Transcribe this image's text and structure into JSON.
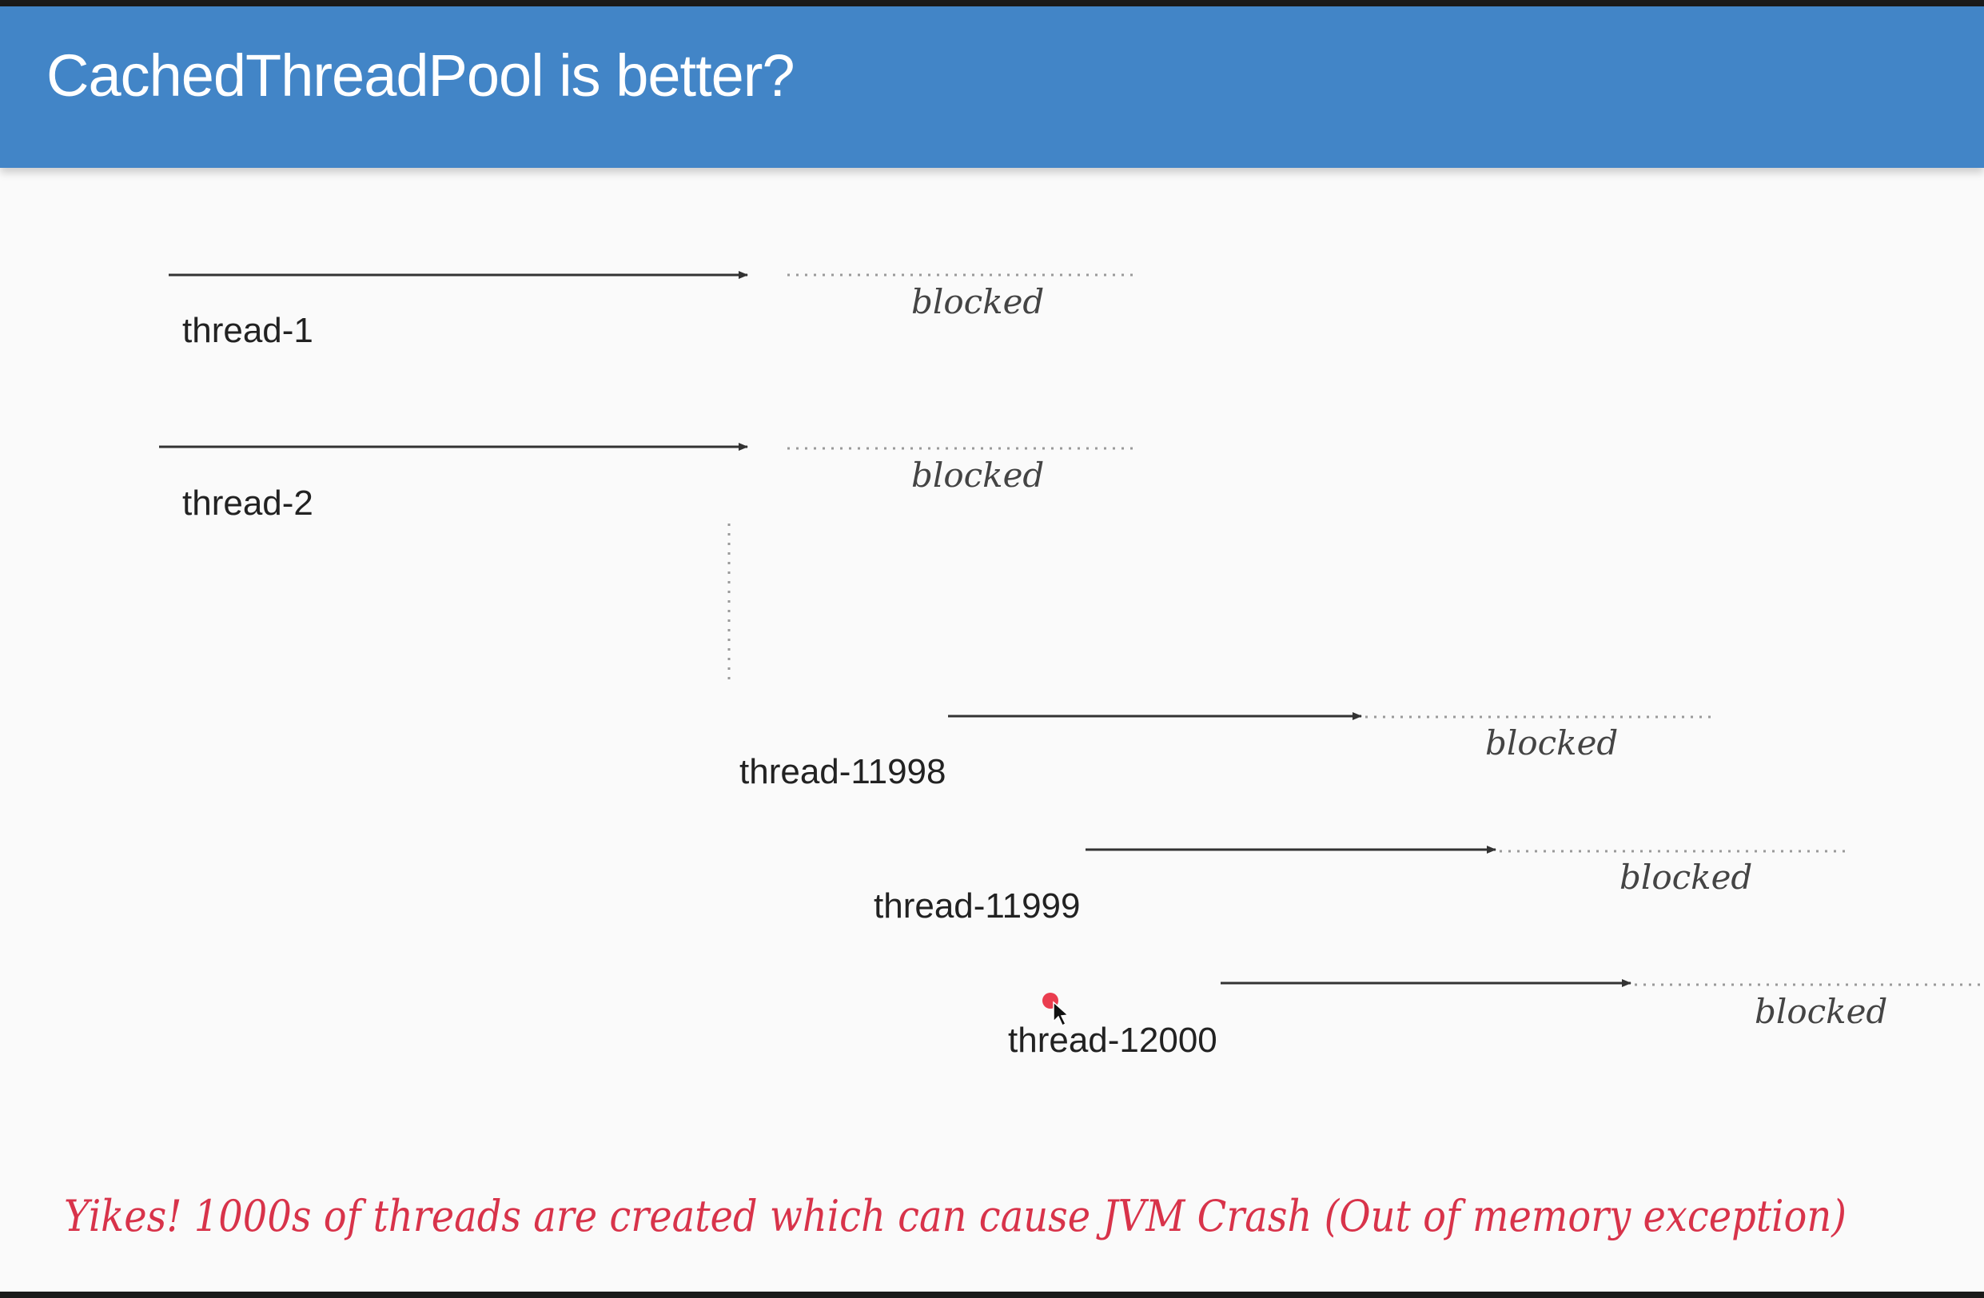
{
  "slide": {
    "title": "CachedThreadPool is better?"
  },
  "threads": [
    {
      "id": "thread-1",
      "label": "thread-1",
      "state": "blocked"
    },
    {
      "id": "thread-2",
      "label": "thread-2",
      "state": "blocked"
    },
    {
      "id": "thread-11998",
      "label": "thread-11998",
      "state": "blocked"
    },
    {
      "id": "thread-11999",
      "label": "thread-11999",
      "state": "blocked"
    },
    {
      "id": "thread-12000",
      "label": "thread-12000",
      "state": "blocked"
    }
  ],
  "caption": "Yikes! 1000s of threads are created which can cause JVM Crash (Out of memory exception)",
  "colors": {
    "header": "#4285c7",
    "caption": "#d8334a",
    "pointer_dot": "#e8283c"
  }
}
